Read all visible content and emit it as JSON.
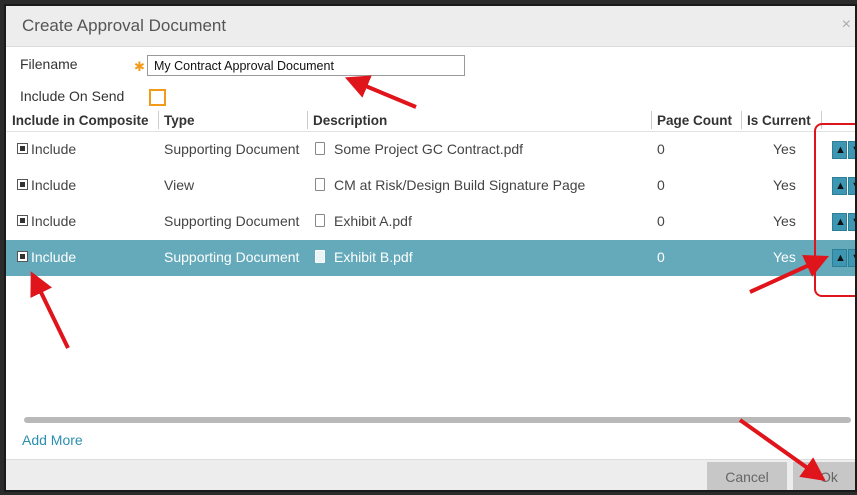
{
  "dialog": {
    "title": "Create Approval Document",
    "close_icon": "×"
  },
  "form": {
    "filename_label": "Filename",
    "filename_value": "My Contract Approval Document",
    "include_on_send_label": "Include On Send"
  },
  "table": {
    "headers": [
      "Include in Composite",
      "Type",
      "Description",
      "Page Count",
      "Is Current"
    ],
    "rows": [
      {
        "include": "Include",
        "type": "Supporting Document",
        "description": "Some Project GC Contract.pdf",
        "page_count": "0",
        "is_current": "Yes"
      },
      {
        "include": "Include",
        "type": "View",
        "description": "CM at Risk/Design Build Signature Page",
        "page_count": "0",
        "is_current": "Yes"
      },
      {
        "include": "Include",
        "type": "Supporting Document",
        "description": "Exhibit A.pdf",
        "page_count": "0",
        "is_current": "Yes"
      },
      {
        "include": "Include",
        "type": "Supporting Document",
        "description": "Exhibit B.pdf",
        "page_count": "0",
        "is_current": "Yes"
      }
    ],
    "selected_row": 4
  },
  "add_more_label": "Add More",
  "buttons": {
    "cancel": "Cancel",
    "ok": "Ok"
  },
  "icons": {
    "up": "▲",
    "down": "▼",
    "document": "document-icon"
  },
  "colors": {
    "selected_row": "#64aabb",
    "required": "#f29b1b",
    "link": "#2b8fb0",
    "annotation": "#e0141b"
  }
}
